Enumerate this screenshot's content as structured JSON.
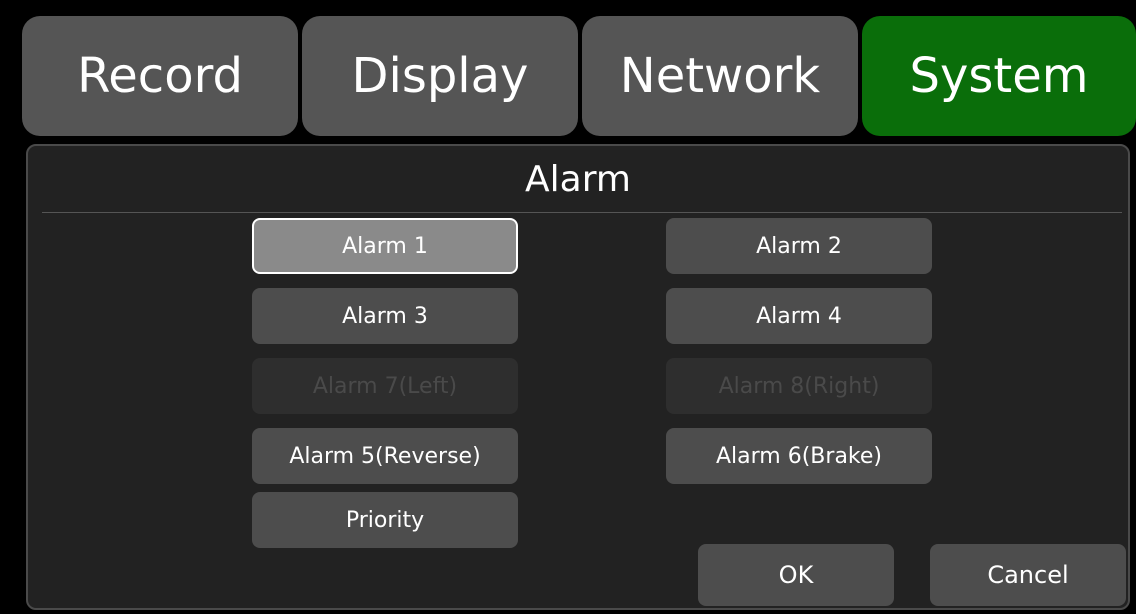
{
  "tabs": [
    {
      "label": "Record"
    },
    {
      "label": "Display"
    },
    {
      "label": "Network"
    },
    {
      "label": "System"
    }
  ],
  "active_tab": "System",
  "panel": {
    "title": "Alarm"
  },
  "alarm_buttons": {
    "alarm1": "Alarm 1",
    "alarm2": "Alarm 2",
    "alarm3": "Alarm 3",
    "alarm4": "Alarm 4",
    "alarm7": "Alarm 7(Left)",
    "alarm8": "Alarm 8(Right)",
    "alarm5": "Alarm 5(Reverse)",
    "alarm6": "Alarm 6(Brake)",
    "priority": "Priority"
  },
  "disabled": [
    "Alarm 7(Left)",
    "Alarm 8(Right)"
  ],
  "selected": "Alarm 1",
  "actions": {
    "ok": "OK",
    "cancel": "Cancel"
  },
  "colors": {
    "active_tab": "#0a6e0a",
    "tab": "#555555",
    "button": "#4d4d4d",
    "selected_button": "#8a8a8a",
    "disabled_button": "#2e2e2e"
  }
}
